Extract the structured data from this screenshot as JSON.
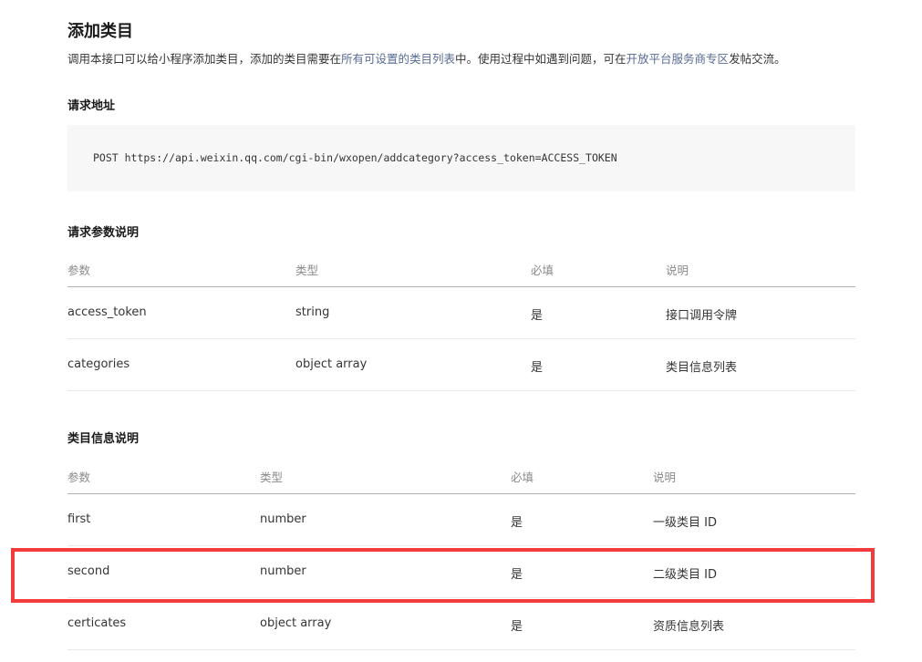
{
  "title": "添加类目",
  "intro": {
    "text1": "调用本接口可以给小程序添加类目，添加的类目需要在",
    "link1": "所有可设置的类目列表",
    "text2": "中。使用过程中如遇到问题，可在",
    "link2": "开放平台服务商专区",
    "text3": "发帖交流。"
  },
  "request_url": {
    "heading": "请求地址",
    "code": "POST https://api.weixin.qq.com/cgi-bin/wxopen/addcategory?access_token=ACCESS_TOKEN"
  },
  "params_table": {
    "heading": "请求参数说明",
    "headers": [
      "参数",
      "类型",
      "必填",
      "说明"
    ],
    "rows": [
      {
        "name": "access_token",
        "type": "string",
        "required": "是",
        "desc": "接口调用令牌",
        "desc_is_link": true
      },
      {
        "name": "categories",
        "type": "object array",
        "required": "是",
        "desc": "类目信息列表",
        "desc_is_link": true
      }
    ]
  },
  "category_table": {
    "heading": "类目信息说明",
    "headers": [
      "参数",
      "类型",
      "必填",
      "说明"
    ],
    "rows": [
      {
        "name": "first",
        "type": "number",
        "required": "是",
        "desc": "一级类目 ID",
        "desc_is_link": false
      },
      {
        "name": "second",
        "type": "number",
        "required": "是",
        "desc": "二级类目 ID",
        "desc_is_link": false
      },
      {
        "name": "certicates",
        "type": "object array",
        "required": "是",
        "desc": "资质信息列表",
        "desc_is_link": true
      }
    ]
  },
  "colors": {
    "link": "#576b95",
    "highlight_border": "#f33b3b",
    "code_bg": "#f7f7f7"
  }
}
